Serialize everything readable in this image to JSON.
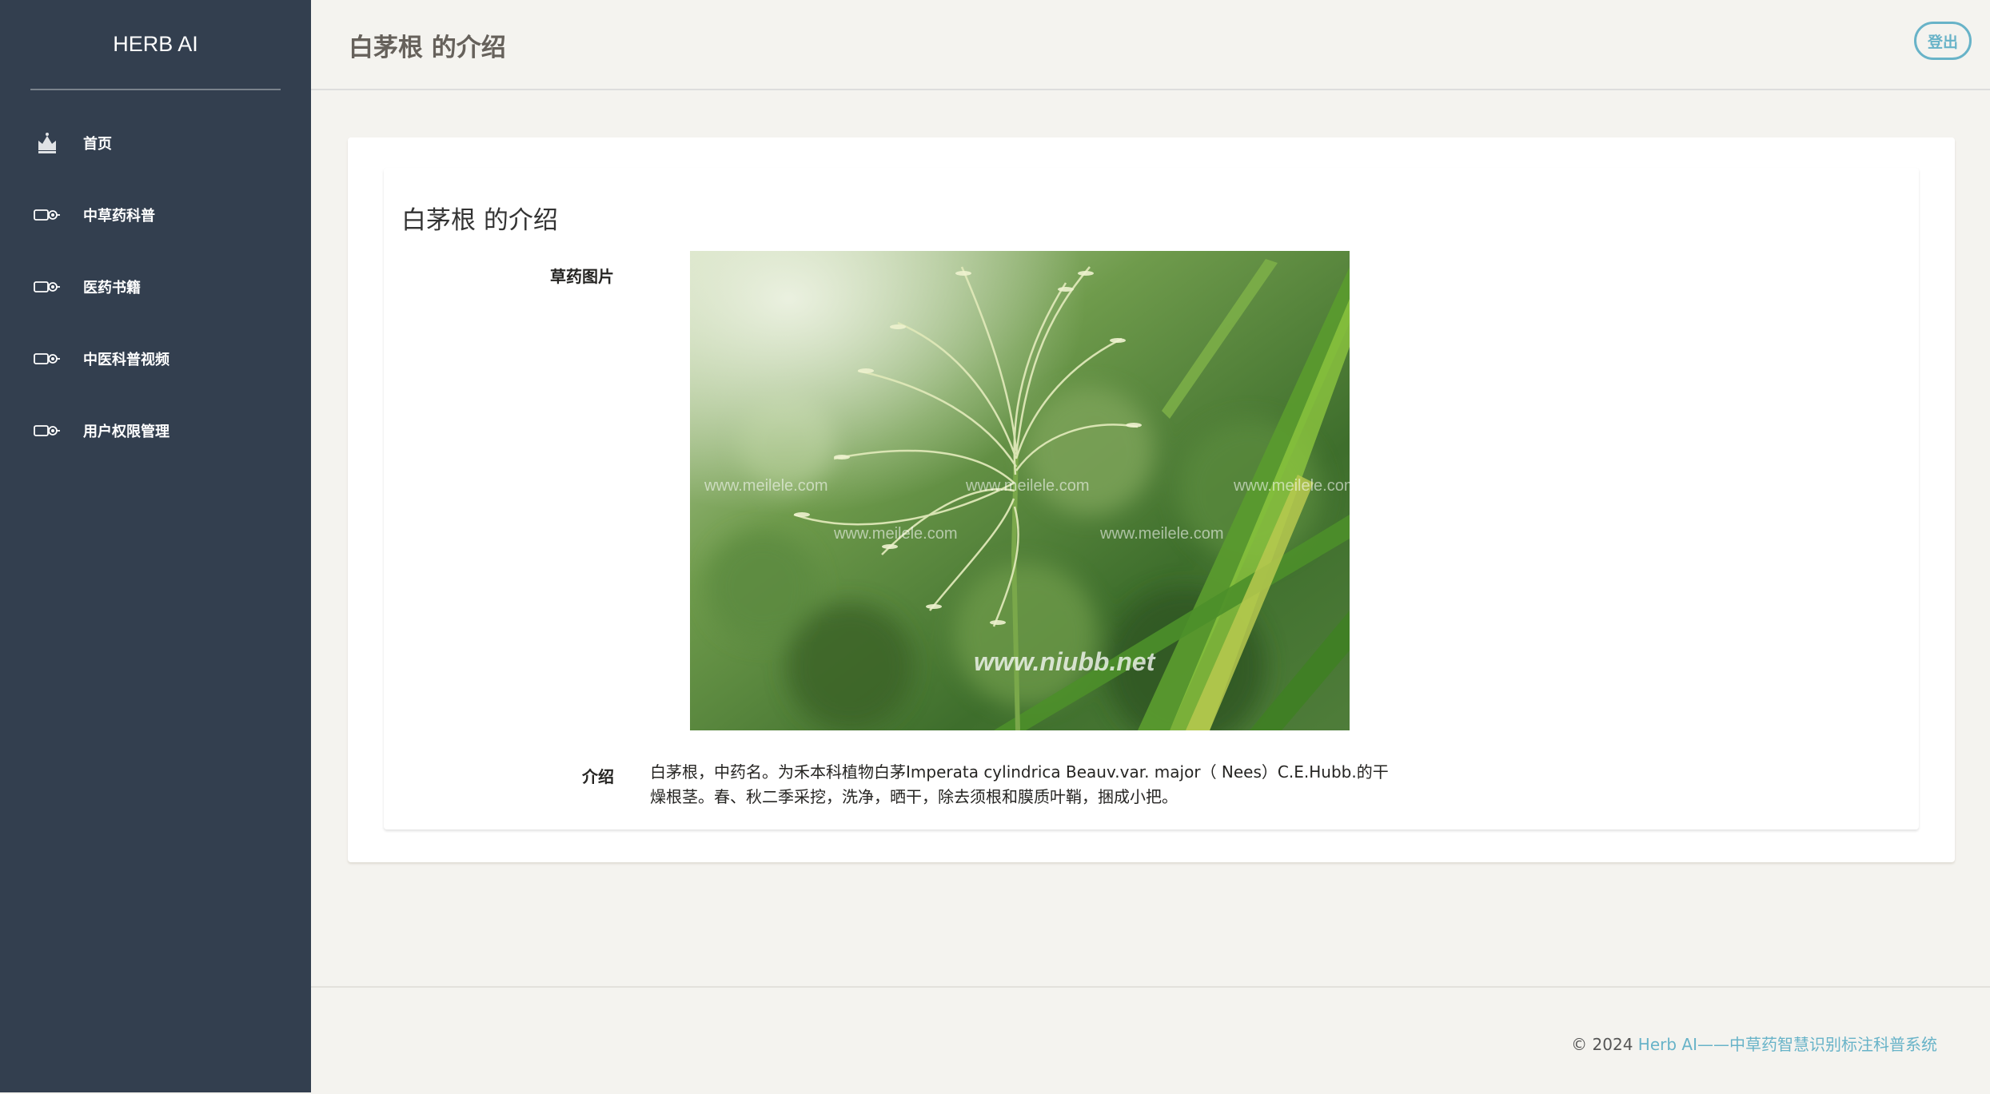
{
  "sidebar": {
    "brand": "HERB AI",
    "items": [
      {
        "label": "首页",
        "icon": "crown-icon"
      },
      {
        "label": "中草药科普",
        "icon": "link-icon"
      },
      {
        "label": "医药书籍",
        "icon": "link-icon"
      },
      {
        "label": "中医科普视频",
        "icon": "link-icon"
      },
      {
        "label": "用户权限管理",
        "icon": "link-icon"
      }
    ]
  },
  "header": {
    "title": "白茅根 的介绍",
    "logout_label": "登出"
  },
  "main": {
    "card_title": "白茅根 的介绍",
    "image_label": "草药图片",
    "intro_label": "介绍",
    "intro_text": "白茅根，中药名。为禾本科植物白茅Imperata cylindrica Beauv.var. major（ Nees）C.E.Hubb.的干燥根茎。春、秋二季采挖，洗净，晒干，除去须根和膜质叶鞘，捆成小把。",
    "image_watermarks": [
      "www.meilele.com",
      "www.meilele.com",
      "www.meilele.com",
      "www.meilele.com",
      "www.meilele.com",
      "www.niubb.net"
    ]
  },
  "footer": {
    "copyright_prefix": "© 2024 ",
    "copyright_link": "Herb AI——中草药智慧识别标注科普系统"
  },
  "colors": {
    "sidebar_bg": "#333f4f",
    "page_bg": "#f4f3ef",
    "accent": "#68b3c8"
  }
}
